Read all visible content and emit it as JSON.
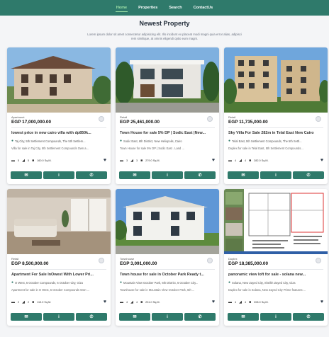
{
  "nav": {
    "items": [
      "Home",
      "Properties",
      "Search",
      "ContactUs"
    ],
    "active": "Home"
  },
  "header": {
    "title": "Newest Property",
    "subtitle": "Lorem ipsum dolor sit amet consectetur adipisicing elit. Illo incidunt ex placeat modi magni quia error alias, adipisci rem similique, at omnis eligendi optio eum magni."
  },
  "colors": {
    "accent": "#2f7a6b",
    "nav_active": "#9fe3a8"
  },
  "listings": [
    {
      "type": "Apartment",
      "price": "EGP 17,000,000.00",
      "title": "lowest price in new cairo villa with dp850k...",
      "location": "Taj City, 5th Settlement Compounds, The 5th Settlem...",
      "description": "Villa for sale in Taj City, 5th Settlement Compounds Own a...",
      "beds": "5",
      "baths": "5",
      "area": "160.0 Sq.M."
    },
    {
      "type": "Retail",
      "price": "EGP 25,461,000.00",
      "title": "Town House for sale 5% DP | Sodic East |New...",
      "location": "Sodic East, 6th District, New Heliopolis, Cairo",
      "description": "Town House for sale 5% DP | Sodic East . Land ...",
      "beds": "3",
      "baths": "3",
      "area": "279.0 Sq.M."
    },
    {
      "type": "Retail",
      "price": "EGP 11,735,000.00",
      "title": "Sky Villa For Sale 282m in Telal East New Cairo",
      "location": "Telal East, 5th Settlement Compounds, The 5th Settl...",
      "description": "Duplex for sale in Telal East, 5th Settlement Compounds...",
      "beds": "4",
      "baths": "4",
      "area": "282.0 Sq.M."
    },
    {
      "type": "Retail",
      "price": "EGP 8,500,000.00",
      "title": "Apartment For Sale InOwest With Lower Pri...",
      "location": "O West, 6 October Compounds, 6 October City, Giza",
      "description": "Apartment for sale in O West, 6 October Compounds Own ...",
      "beds": "2",
      "baths": "2",
      "area": "113.0 Sq.M."
    },
    {
      "type": "Townhouse",
      "price": "EGP 3,091,000.00",
      "title": "Town house for sale in October Park Ready t...",
      "location": "Mountain View October Park, 6th District, 6 October City...",
      "description": "Townhouse for sale in Mountain View October Park, 6th ...",
      "beds": "4",
      "baths": "4",
      "area": "231.0 Sq.M."
    },
    {
      "type": "Duplex",
      "price": "EGP 18,385,000.00",
      "title": "panoramic view loft for sale - solana new...",
      "location": "Solana, New Zayed City, Sheikh Zayed City, Giza",
      "description": "Duplex for sale in Solana, New Zayed City Prime features:...",
      "beds": "4",
      "baths": "4",
      "area": "208.0 Sq.M."
    }
  ],
  "icons": {
    "email": "envelope-icon",
    "info": "info-icon",
    "whatsapp": "whatsapp-icon",
    "favorite": "heart-icon",
    "bed": "bed-icon",
    "bath": "bath-icon",
    "area": "area-icon",
    "location": "map-pin-icon"
  }
}
